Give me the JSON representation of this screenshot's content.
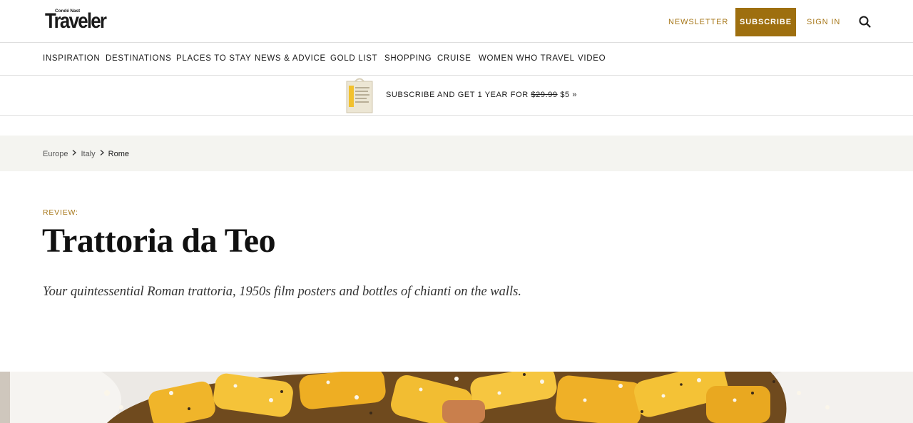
{
  "header": {
    "logo_small": "Condé Nast",
    "logo_big": "Traveler",
    "newsletter_label": "NEWSLETTER",
    "subscribe_label": "SUBSCRIBE",
    "signin_label": "SIGN IN",
    "search_icon": "search-icon",
    "accent_color": "#a67617",
    "subscribe_bg": "#9e6f0f"
  },
  "nav": {
    "items": [
      {
        "label": "INSPIRATION"
      },
      {
        "label": "DESTINATIONS"
      },
      {
        "label": "PLACES TO STAY"
      },
      {
        "label": "NEWS & ADVICE"
      },
      {
        "label": "GOLD LIST"
      },
      {
        "label": "SHOPPING"
      },
      {
        "label": "CRUISE"
      },
      {
        "label": "WOMEN WHO TRAVEL"
      },
      {
        "label": "VIDEO"
      }
    ]
  },
  "promo": {
    "text_before": "SUBSCRIBE AND GET 1 YEAR FOR ",
    "old_price": "$29.99",
    "new_price": " $5 »"
  },
  "breadcrumb": {
    "items": [
      {
        "label": "Europe"
      },
      {
        "label": "Italy"
      },
      {
        "label": "Rome"
      }
    ],
    "separator_icon": "chevron-right-icon"
  },
  "article": {
    "kicker": "REVIEW:",
    "title": "Trattoria da Teo",
    "dek": "Your quintessential Roman trattoria, 1950s film posters and bottles of chianti on the walls."
  }
}
